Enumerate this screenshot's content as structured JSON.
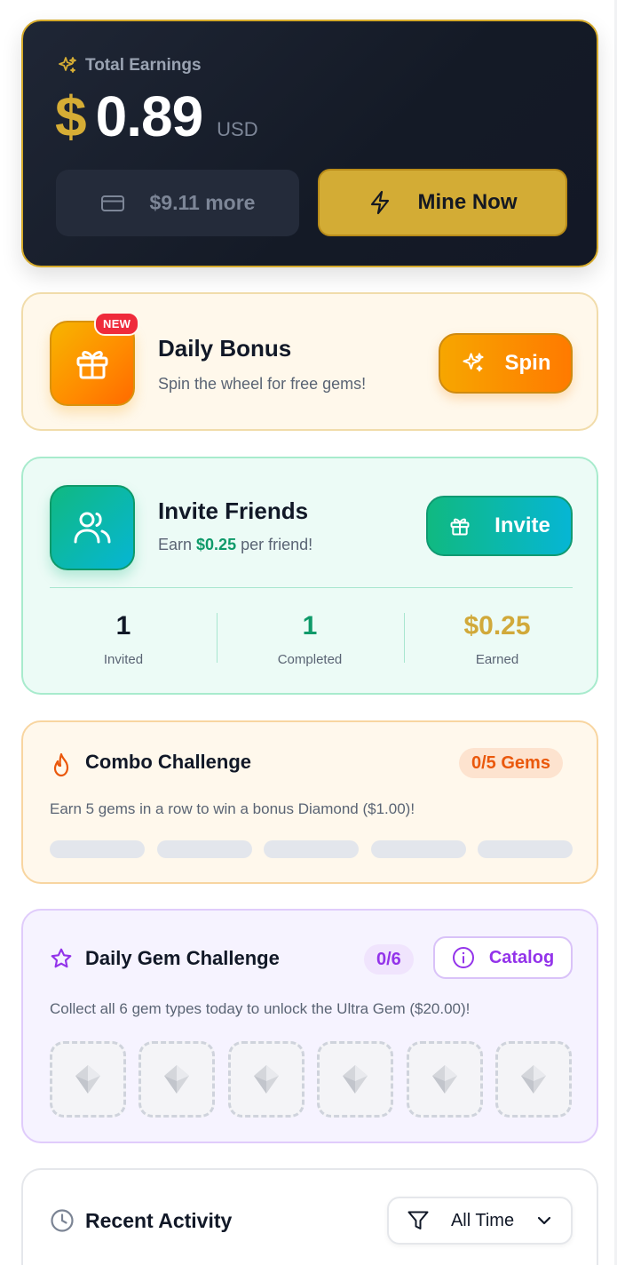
{
  "earnings": {
    "label": "Total Earnings",
    "currency_symbol": "$",
    "amount": "0.89",
    "unit": "USD",
    "more_label": "$9.11 more",
    "mine_label": "Mine Now",
    "accent": "#d6ad35"
  },
  "daily_bonus": {
    "badge": "NEW",
    "title": "Daily Bonus",
    "subtitle": "Spin the wheel for free gems!",
    "button": "Spin"
  },
  "invite": {
    "title": "Invite Friends",
    "subtitle_prefix": "Earn ",
    "subtitle_amount": "$0.25",
    "subtitle_suffix": " per friend!",
    "button": "Invite",
    "stats": [
      {
        "value": "1",
        "label": "Invited",
        "color": "#111827"
      },
      {
        "value": "1",
        "label": "Completed",
        "color": "#0f9a6a"
      },
      {
        "value": "$0.25",
        "label": "Earned",
        "color": "#d1a93a"
      }
    ]
  },
  "combo": {
    "title": "Combo Challenge",
    "badge": "0/5 Gems",
    "description": "Earn 5 gems in a row to win a bonus Diamond ($1.00)!",
    "progress": 0
  },
  "gem_challenge": {
    "title": "Daily Gem Challenge",
    "badge": "0/6",
    "catalog_button": "Catalog",
    "description": "Collect all 6 gem types today to unlock the Ultra Gem ($20.00)!",
    "collected": 0
  },
  "recent_activity": {
    "title": "Recent Activity",
    "filter_value": "All Time"
  }
}
